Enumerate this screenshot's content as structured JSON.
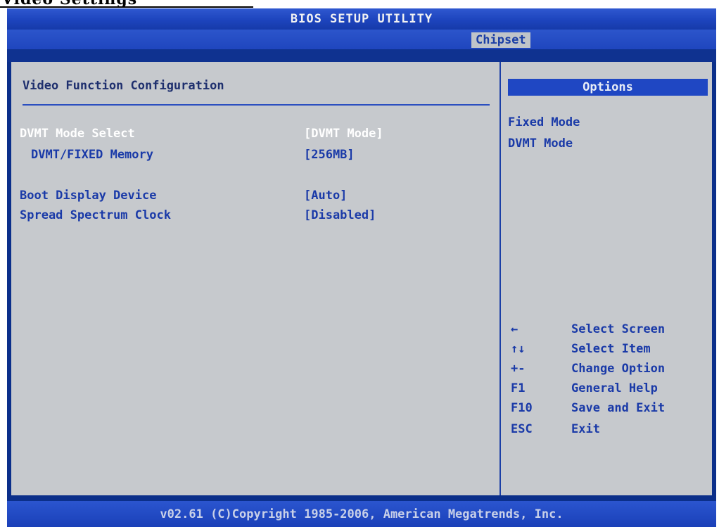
{
  "cropped_header": "Video Settings",
  "title": "BIOS SETUP UTILITY",
  "active_tab": "Chipset",
  "section_title": "Video Function Configuration",
  "settings": [
    {
      "label": "DVMT Mode Select",
      "value": "[DVMT Mode]",
      "selected": true
    },
    {
      "label": "DVMT/FIXED Memory",
      "value": "[256MB]",
      "selected": false
    },
    {
      "label": "Boot Display Device",
      "value": "[Auto]",
      "selected": false
    },
    {
      "label": "Spread Spectrum Clock",
      "value": "[Disabled]",
      "selected": false
    }
  ],
  "options_header": "Options",
  "options": [
    "Fixed Mode",
    "DVMT Mode"
  ],
  "key_help": [
    {
      "key": "←",
      "desc": "Select Screen"
    },
    {
      "key": "↑↓",
      "desc": "Select Item"
    },
    {
      "key": "+-",
      "desc": "Change Option"
    },
    {
      "key": "F1",
      "desc": "General Help"
    },
    {
      "key": "F10",
      "desc": "Save and Exit"
    },
    {
      "key": "ESC",
      "desc": "Exit"
    }
  ],
  "footer": "v02.61 (C)Copyright 1985-2006, American Megatrends, Inc.",
  "colors": {
    "background": "#0b2f8a",
    "panel": "#c6c9cd",
    "text": "#1a3aa8",
    "selected_text": "#ffffff",
    "header": "#1f47c3"
  }
}
